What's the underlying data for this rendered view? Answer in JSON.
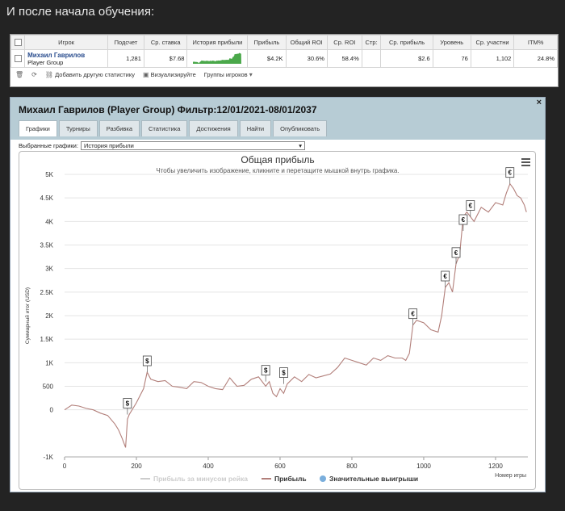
{
  "heading": "И после начала обучения:",
  "stats_table": {
    "columns": [
      "Игрок",
      "Подсчет",
      "Ср. ставка",
      "История прибыли",
      "Прибыль",
      "Общий ROI",
      "Ср. ROI",
      "Стр:",
      "Ср. прибыль",
      "Уровень",
      "Ср. участни",
      "ITM%"
    ],
    "row": {
      "player_name": "Михаил Гаврилов",
      "player_group": "Player Group",
      "count": "1,281",
      "avg_stake": "$7.68",
      "profit": "$4.2K",
      "total_roi": "30.6%",
      "avg_roi": "58.4%",
      "str": "",
      "avg_profit": "$2.6",
      "level": "76",
      "avg_participants": "1,102",
      "itm": "24.8%"
    }
  },
  "toolbar": {
    "add_stat": "Добавить другую статистику",
    "visualize": "Визуализируйте",
    "player_groups": "Группы игроков"
  },
  "dialog": {
    "title": "Михаил Гаврилов (Player Group) Фильтр:12/01/2021-08/01/2037",
    "close": "×",
    "tabs": [
      "Графики",
      "Турниры",
      "Разбивка",
      "Статистика",
      "Достижения",
      "Найти",
      "Опубликовать"
    ],
    "selector_label": "Выбранные графики:",
    "selector_value": "История прибыли"
  },
  "chart_data": {
    "type": "line",
    "title": "Общая прибыль",
    "subtitle": "Чтобы увеличить изображение, кликните и перетащите мышкой внутрь графика.",
    "ylabel": "Суммарный итог (USD)",
    "xlabel": "Номер игры",
    "ylim": [
      -1000,
      5000
    ],
    "xlim": [
      0,
      1290
    ],
    "y_ticks": [
      "-1K",
      "0",
      "500",
      "1K",
      "1.5K",
      "2K",
      "2.5K",
      "3K",
      "3.5K",
      "4K",
      "4.5K",
      "5K"
    ],
    "y_tick_values": [
      -1000,
      0,
      500,
      1000,
      1500,
      2000,
      2500,
      3000,
      3500,
      4000,
      4500,
      5000
    ],
    "x_ticks": [
      0,
      200,
      400,
      600,
      800,
      1000,
      1200
    ],
    "grid": true,
    "legend": [
      "Прибыль за минусом рейка",
      "Прибыль",
      "Значительные выигрыши"
    ],
    "legend_colors": [
      "#cccccc",
      "#b27f7a",
      "#7aaedc"
    ],
    "line_color": "#b27f7a",
    "series": [
      {
        "name": "Прибыль",
        "x": [
          0,
          20,
          40,
          60,
          80,
          100,
          120,
          140,
          150,
          160,
          170,
          175,
          180,
          200,
          220,
          230,
          240,
          260,
          280,
          300,
          320,
          340,
          360,
          380,
          400,
          420,
          440,
          460,
          480,
          500,
          520,
          540,
          560,
          570,
          580,
          590,
          600,
          610,
          620,
          640,
          660,
          680,
          700,
          720,
          740,
          760,
          780,
          800,
          820,
          840,
          860,
          880,
          900,
          920,
          940,
          950,
          960,
          970,
          980,
          1000,
          1020,
          1040,
          1050,
          1060,
          1070,
          1080,
          1090,
          1100,
          1110,
          1120,
          1140,
          1160,
          1180,
          1200,
          1220,
          1230,
          1240,
          1250,
          1260,
          1270,
          1280,
          1286
        ],
        "y": [
          0,
          100,
          80,
          30,
          0,
          -70,
          -120,
          -300,
          -420,
          -600,
          -800,
          -200,
          -100,
          150,
          450,
          800,
          650,
          600,
          620,
          500,
          480,
          450,
          600,
          580,
          500,
          450,
          430,
          680,
          500,
          520,
          650,
          700,
          500,
          600,
          350,
          280,
          450,
          350,
          550,
          700,
          600,
          750,
          680,
          720,
          760,
          900,
          1100,
          1050,
          1000,
          950,
          1100,
          1050,
          1150,
          1100,
          1100,
          1050,
          1200,
          1800,
          1900,
          1850,
          1700,
          1650,
          2000,
          2600,
          2700,
          2500,
          3100,
          3300,
          4100,
          4200,
          4000,
          4300,
          4200,
          4400,
          4350,
          4600,
          4800,
          4700,
          4550,
          4500,
          4350,
          4200
        ]
      }
    ],
    "big_wins": [
      {
        "x": 175,
        "y": -100,
        "symbol": "$"
      },
      {
        "x": 230,
        "y": 800,
        "symbol": "$"
      },
      {
        "x": 560,
        "y": 600,
        "symbol": "$"
      },
      {
        "x": 610,
        "y": 550,
        "symbol": "$"
      },
      {
        "x": 970,
        "y": 1800,
        "symbol": "€"
      },
      {
        "x": 1060,
        "y": 2600,
        "symbol": "€"
      },
      {
        "x": 1090,
        "y": 3100,
        "symbol": "€"
      },
      {
        "x": 1110,
        "y": 3800,
        "symbol": "€"
      },
      {
        "x": 1130,
        "y": 4100,
        "symbol": "€"
      },
      {
        "x": 1240,
        "y": 4800,
        "symbol": "€"
      }
    ],
    "sparkline_color": "#4aa84a"
  }
}
